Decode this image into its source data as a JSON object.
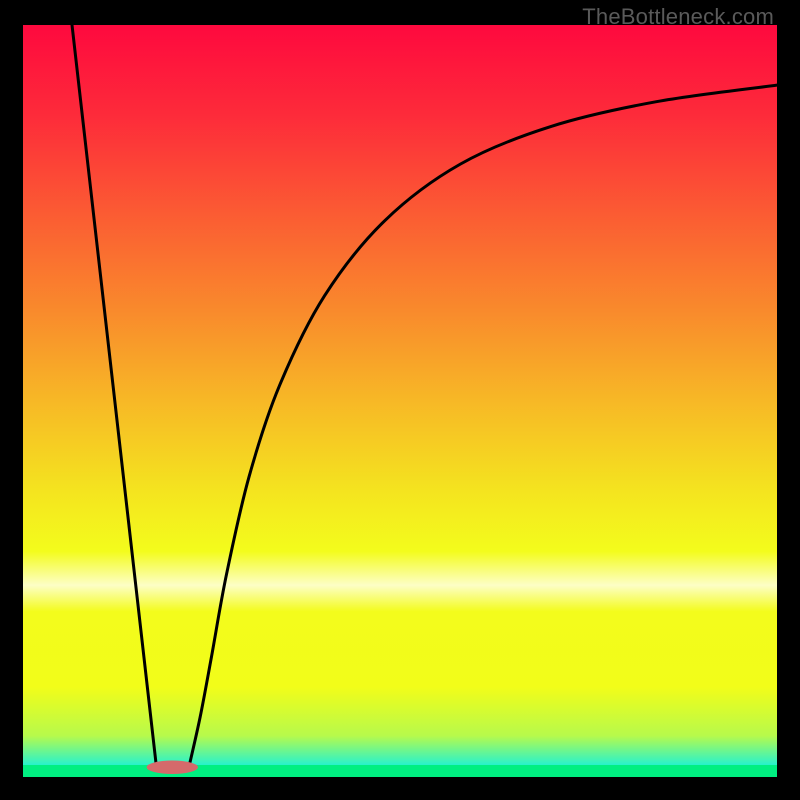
{
  "watermark": "TheBottleneck.com",
  "colors": {
    "black": "#000000",
    "curve": "#000000",
    "marker_fill": "#d56a6b",
    "gradient_stops": [
      {
        "offset": 0.0,
        "color": "#fe093e"
      },
      {
        "offset": 0.12,
        "color": "#fd2b3a"
      },
      {
        "offset": 0.25,
        "color": "#fb5b33"
      },
      {
        "offset": 0.38,
        "color": "#f98a2c"
      },
      {
        "offset": 0.5,
        "color": "#f7b826"
      },
      {
        "offset": 0.62,
        "color": "#f4e41f"
      },
      {
        "offset": 0.7,
        "color": "#f3fc1c"
      },
      {
        "offset": 0.745,
        "color": "#fdfec6"
      },
      {
        "offset": 0.78,
        "color": "#f3fc1c"
      },
      {
        "offset": 0.88,
        "color": "#f2fd19"
      },
      {
        "offset": 0.945,
        "color": "#b7fa4b"
      },
      {
        "offset": 0.965,
        "color": "#6cf68f"
      },
      {
        "offset": 0.985,
        "color": "#24f2d0"
      },
      {
        "offset": 1.0,
        "color": "#05f0ee"
      }
    ],
    "bottom_band": "#00ef81"
  },
  "chart_data": {
    "type": "line",
    "title": "",
    "xlabel": "",
    "ylabel": "",
    "xlim": [
      0,
      100
    ],
    "ylim": [
      0,
      100
    ],
    "note": "Values are approximate percentages of plot width (x) and height (y), y=0 at bottom.",
    "series": [
      {
        "name": "left-linear-descent",
        "x": [
          6.5,
          17.7
        ],
        "y": [
          100,
          1.3
        ]
      },
      {
        "name": "right-curve",
        "x": [
          22.0,
          23.5,
          25.0,
          27.0,
          30.0,
          34.0,
          40.0,
          48.0,
          58.0,
          70.0,
          84.0,
          100.0
        ],
        "y": [
          1.3,
          8.0,
          16.0,
          27.0,
          40.0,
          52.0,
          64.0,
          74.0,
          81.5,
          86.5,
          89.8,
          92.0
        ]
      }
    ],
    "marker": {
      "name": "valley-marker",
      "x_center": 19.8,
      "y_center": 1.3,
      "rx_pct": 3.4,
      "ry_pct": 0.9
    }
  }
}
